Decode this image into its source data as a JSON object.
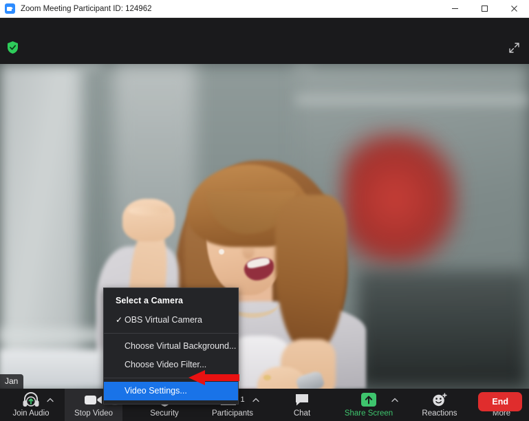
{
  "window": {
    "title": "Zoom Meeting Participant ID: 124962",
    "app_icon": "zoom-logo-icon",
    "controls": {
      "minimize": "minimize-icon",
      "maximize": "maximize-icon",
      "close": "close-icon"
    }
  },
  "meeting_header": {
    "encryption_icon": "green-shield-check-icon",
    "fullscreen_icon": "enter-full-screen-icon"
  },
  "video": {
    "participant_name": "Jan"
  },
  "camera_menu": {
    "header": "Select a Camera",
    "items": [
      {
        "label": "OBS Virtual Camera",
        "checked": true,
        "highlighted": false
      },
      {
        "label": "Choose Virtual Background...",
        "checked": false,
        "highlighted": false
      },
      {
        "label": "Choose Video Filter...",
        "checked": false,
        "highlighted": false
      },
      {
        "label": "Video Settings...",
        "checked": false,
        "highlighted": true
      }
    ],
    "highlight_color": "#1973e8",
    "annotation_arrow": "red-left-arrow-pointer"
  },
  "toolbar": {
    "items": [
      {
        "label": "Join Audio",
        "icon": "headset-join-audio-icon",
        "caret": true,
        "caret_boxed": false,
        "count": "",
        "green": false,
        "active": false
      },
      {
        "label": "Stop Video",
        "icon": "video-camera-icon",
        "caret": true,
        "caret_boxed": true,
        "count": "",
        "green": false,
        "active": true
      },
      {
        "label": "Security",
        "icon": "shield-security-icon",
        "caret": false,
        "caret_boxed": false,
        "count": "",
        "green": false,
        "active": false
      },
      {
        "label": "Participants",
        "icon": "participants-people-icon",
        "caret": true,
        "caret_boxed": false,
        "count": "1",
        "green": false,
        "active": false
      },
      {
        "label": "Chat",
        "icon": "chat-bubble-icon",
        "caret": false,
        "caret_boxed": false,
        "count": "",
        "green": false,
        "active": false
      },
      {
        "label": "Share Screen",
        "icon": "share-screen-up-arrow-icon",
        "caret": true,
        "caret_boxed": false,
        "count": "",
        "green": true,
        "active": false
      },
      {
        "label": "Reactions",
        "icon": "smiley-reactions-icon",
        "caret": false,
        "caret_boxed": false,
        "count": "",
        "green": false,
        "active": false
      },
      {
        "label": "More",
        "icon": "more-ellipsis-icon",
        "caret": false,
        "caret_boxed": false,
        "count": "",
        "green": false,
        "active": false
      }
    ],
    "end_label": "End",
    "end_color": "#e02d2d",
    "accent_green": "#3ec46d"
  }
}
